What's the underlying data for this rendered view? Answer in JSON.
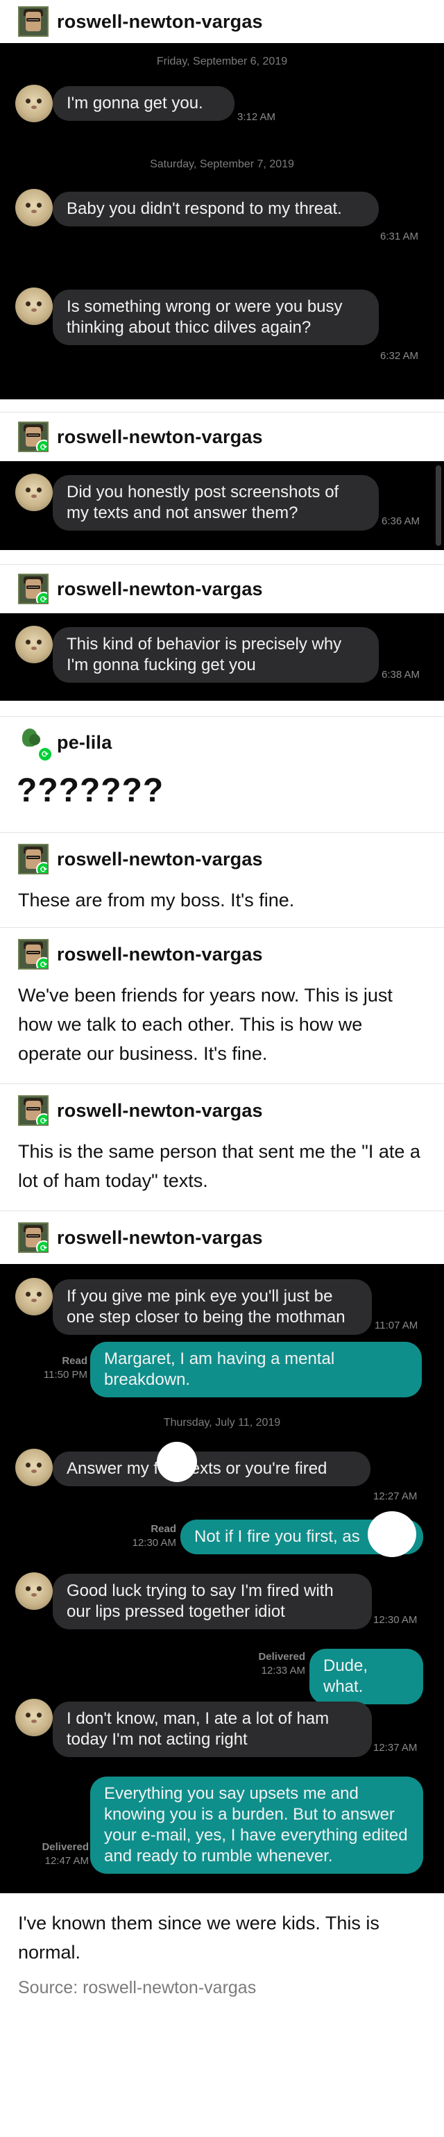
{
  "posts": [
    {
      "username": "roswell-newton-vargas"
    },
    {
      "username": "roswell-newton-vargas"
    },
    {
      "username": "roswell-newton-vargas"
    },
    {
      "username": "pe-lila",
      "body": "???????"
    },
    {
      "username": "roswell-newton-vargas",
      "body": "These are from my boss. It's fine."
    },
    {
      "username": "roswell-newton-vargas",
      "body": "We've been friends for years now. This is just how we talk to each other. This is how we operate our business. It's fine."
    },
    {
      "username": "roswell-newton-vargas",
      "body": "This is the same person that sent me the \"I ate a lot of ham today\" texts."
    },
    {
      "username": "roswell-newton-vargas"
    }
  ],
  "shot1": {
    "date1": "Friday, September 6, 2019",
    "msg1": {
      "text": "I'm gonna get you.",
      "time": "3:12 AM"
    },
    "date2": "Saturday, September 7, 2019",
    "msg2": {
      "text": "Baby you didn't respond to my threat.",
      "time": "6:31 AM"
    },
    "msg3": {
      "text": "Is something wrong or were you busy thinking about thicc dilves again?",
      "time": "6:32 AM"
    }
  },
  "shot2": {
    "msg1": {
      "text": "Did you honestly post screenshots of my texts and not answer them?",
      "time": "6:36 AM"
    }
  },
  "shot3": {
    "msg1": {
      "text": "This kind of behavior is precisely why I'm gonna fucking get you",
      "time": "6:38 AM"
    }
  },
  "shot4": {
    "msg1": {
      "text": "If you give me pink eye you'll just be one step closer to being the mothman",
      "time": "11:07 AM"
    },
    "out1": {
      "text": "Margaret, I am having a mental breakdown.",
      "status": "Read",
      "time": "11:50 PM"
    },
    "date1": "Thursday, July 11, 2019",
    "msg2": {
      "text": "Answer my fu      g texts or you're fired",
      "time": "12:27 AM"
    },
    "out2": {
      "text": "Not if I fire you first, as",
      "status": "Read",
      "time": "12:30 AM"
    },
    "msg3": {
      "text": "Good luck trying to say I'm fired with our lips pressed together idiot",
      "time": "12:30 AM"
    },
    "out3": {
      "text": "Dude, what.",
      "status": "Delivered",
      "time": "12:33 AM"
    },
    "msg4": {
      "text": "I don't know, man, I ate a lot of ham today I'm not acting right",
      "time": "12:37 AM"
    },
    "out4": {
      "text": "Everything you say upsets me and knowing you is a burden. But to answer your e-mail, yes, I have everything edited and ready to rumble whenever.",
      "status": "Delivered",
      "time": "12:47 AM"
    }
  },
  "footer": {
    "body": "I've known them since we were kids. This is normal.",
    "source": "Source: roswell-newton-vargas"
  },
  "colors": {
    "bubble_in": "#2c2c2e",
    "bubble_out": "#0f8f8b",
    "reblog_badge": "#00cf35",
    "screenshot_bg": "#000000"
  }
}
